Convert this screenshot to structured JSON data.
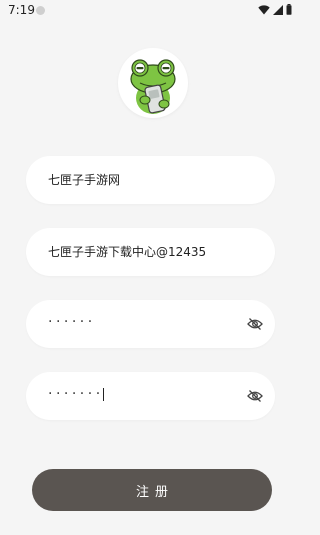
{
  "status_bar": {
    "time": "7:19",
    "icons": [
      "wifi-icon",
      "signal-icon",
      "battery-icon"
    ]
  },
  "avatar": {
    "icon": "frog-logo"
  },
  "form": {
    "site_name": "七匣子手游网",
    "account": "七匣子手游下载中心@12435",
    "password_mask": "······",
    "confirm_mask": "·······",
    "submit_label": "注册"
  },
  "colors": {
    "background": "#f5f5f5",
    "field": "#ffffff",
    "button": "#5a5551",
    "frog_green": "#7ec443"
  }
}
